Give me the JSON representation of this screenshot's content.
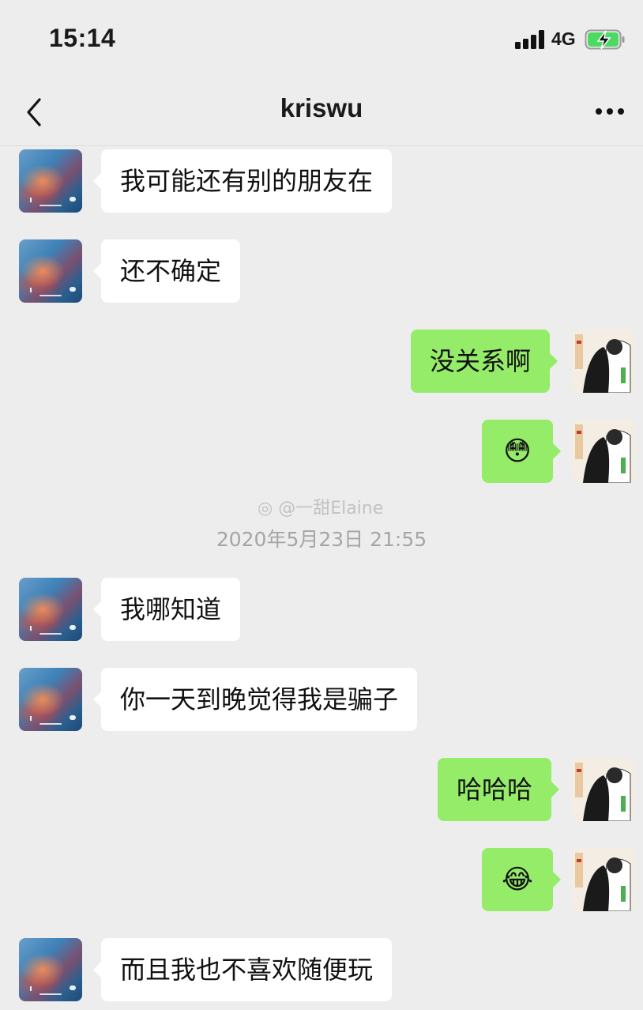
{
  "status_bar": {
    "time": "15:14",
    "network": "4G",
    "battery_state": "charging"
  },
  "header": {
    "title": "kriswu",
    "back_icon": "chevron-left-icon",
    "more_icon": "more-dots-icon"
  },
  "messages": [
    {
      "side": "in",
      "text": "我可能还有别的朋友在"
    },
    {
      "side": "in",
      "text": "还不确定"
    },
    {
      "side": "out",
      "text": "没关系啊"
    },
    {
      "side": "out",
      "text": "😳"
    },
    {
      "side": "in",
      "text": "我哪知道"
    },
    {
      "side": "in",
      "text": "你一天到晚觉得我是骗子"
    },
    {
      "side": "out",
      "text": "哈哈哈"
    },
    {
      "side": "out",
      "text": "😂"
    },
    {
      "side": "in",
      "text": "而且我也不喜欢随便玩"
    }
  ],
  "timestamp": "2020年5月23日 21:55",
  "watermark": "@一甜Elaine",
  "colors": {
    "background": "#ededed",
    "outgoing_bubble": "#95ec69",
    "incoming_bubble": "#ffffff",
    "timestamp_text": "#a5a5a5"
  }
}
